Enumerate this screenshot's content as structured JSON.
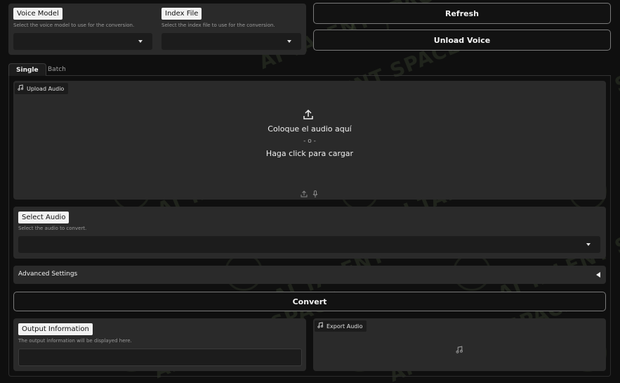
{
  "model_panel": {
    "voice_model_label": "Voice Model",
    "voice_model_desc": "Select the voice model to use for the conversion.",
    "voice_model_value": "",
    "index_file_label": "Index File",
    "index_file_desc": "Select the index file to use for the conversion.",
    "index_file_value": ""
  },
  "buttons": {
    "refresh": "Refresh",
    "unload_voice": "Unload Voice",
    "convert": "Convert"
  },
  "tabs": [
    {
      "label": "Single",
      "active": true
    },
    {
      "label": "Batch",
      "active": false
    }
  ],
  "upload": {
    "label": "Upload Audio",
    "drop_text": "Coloque el audio aquí",
    "or_text": "- o -",
    "click_text": "Haga click para cargar"
  },
  "select_audio": {
    "label": "Select Audio",
    "desc": "Select the audio to convert.",
    "value": ""
  },
  "advanced": {
    "label": "Advanced Settings"
  },
  "output": {
    "label": "Output Information",
    "desc": "The output information will be displayed here.",
    "value": ""
  },
  "export": {
    "label": "Export Audio"
  },
  "watermark": {
    "text": "AI TALENT SPACE"
  },
  "colors": {
    "background": "#0f0f0f",
    "panel": "#2a2a2a",
    "label_bg": "#f2f2f2"
  }
}
